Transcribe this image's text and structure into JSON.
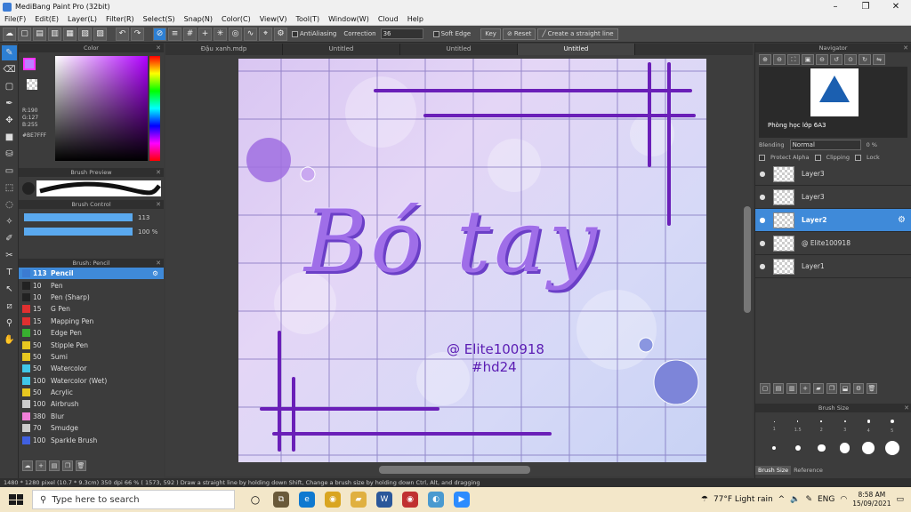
{
  "window": {
    "title": "MediBang Paint Pro (32bit)",
    "min": "–",
    "max": "❐",
    "close": "✕"
  },
  "menu": [
    "File(F)",
    "Edit(E)",
    "Layer(L)",
    "Filter(R)",
    "Select(S)",
    "Snap(N)",
    "Color(C)",
    "View(V)",
    "Tool(T)",
    "Window(W)",
    "Cloud",
    "Help"
  ],
  "toolbar": {
    "antialiasing_label": "AntiAliasing",
    "correction_label": "Correction",
    "correction_value": "36",
    "soft_edge_label": "Soft Edge",
    "key_label": "Key",
    "reset_label": "Reset",
    "straight_line_label": "Create a straight line"
  },
  "panels": {
    "color": "Color",
    "brush_preview": "Brush Preview",
    "brush_control": "Brush Control",
    "brush_list": "Brush: Pencil",
    "navigator": "Navigator",
    "brush_size": "Brush Size"
  },
  "color": {
    "r": "R:190",
    "g": "G:127",
    "b": "B:255",
    "hex": "#BE7FFF",
    "foreground": "#be7fff"
  },
  "brush_control": {
    "size": "113",
    "opacity": "100 %"
  },
  "brushes": [
    {
      "size": "113",
      "name": "Pencil",
      "color": "#3b7bd1"
    },
    {
      "size": "10",
      "name": "Pen",
      "color": "#222222"
    },
    {
      "size": "10",
      "name": "Pen (Sharp)",
      "color": "#222222"
    },
    {
      "size": "15",
      "name": "G Pen",
      "color": "#e03030"
    },
    {
      "size": "15",
      "name": "Mapping Pen",
      "color": "#e03030"
    },
    {
      "size": "10",
      "name": "Edge Pen",
      "color": "#38b030"
    },
    {
      "size": "50",
      "name": "Stipple Pen",
      "color": "#e8c820"
    },
    {
      "size": "50",
      "name": "Sumi",
      "color": "#e8c820"
    },
    {
      "size": "50",
      "name": "Watercolor",
      "color": "#40c8e8"
    },
    {
      "size": "100",
      "name": "Watercolor (Wet)",
      "color": "#40c8e8"
    },
    {
      "size": "50",
      "name": "Acrylic",
      "color": "#e8c820"
    },
    {
      "size": "100",
      "name": "Airbrush",
      "color": "#cccccc"
    },
    {
      "size": "380",
      "name": "Blur",
      "color": "#f080d8"
    },
    {
      "size": "70",
      "name": "Smudge",
      "color": "#cccccc"
    },
    {
      "size": "100",
      "name": "Sparkle Brush",
      "color": "#4060e0"
    }
  ],
  "tabs": [
    "Đậu xanh.mdp",
    "Untitled",
    "Untitled",
    "Untitled"
  ],
  "canvas": {
    "title_text": "Bó tay",
    "credit_line1": "@ Elite100918",
    "credit_line2": "#hd24"
  },
  "navigator": {
    "caption": "Phòng học lớp 6A3",
    "blending_label": "Blending",
    "blending_value": "Normal",
    "opacity_value": "0 %"
  },
  "layer_options": {
    "protect_alpha": "Protect Alpha",
    "clipping": "Clipping",
    "lock": "Lock"
  },
  "layers": [
    {
      "name": "Layer3",
      "selected": false
    },
    {
      "name": "Layer3",
      "selected": false
    },
    {
      "name": "Layer2",
      "selected": true
    },
    {
      "name": "@ Elite100918",
      "selected": false
    },
    {
      "name": "Layer1",
      "selected": false
    }
  ],
  "brush_size_values": [
    "1",
    "1.5",
    "2",
    "3",
    "4",
    "5"
  ],
  "brush_size_tabs": [
    "Brush Size",
    "Reference"
  ],
  "status": "1480 * 1280 pixel  (10.7 * 9.3cm)  350 dpi  66 %  ( 1573, 592 )  Draw a straight line by holding down Shift, Change a brush size by holding down Ctrl, Alt, and dragging",
  "taskbar": {
    "search_placeholder": "Type here to search",
    "weather": "77°F  Light rain",
    "lang": "ENG",
    "time": "8:58 AM",
    "date": "15/09/2021"
  }
}
